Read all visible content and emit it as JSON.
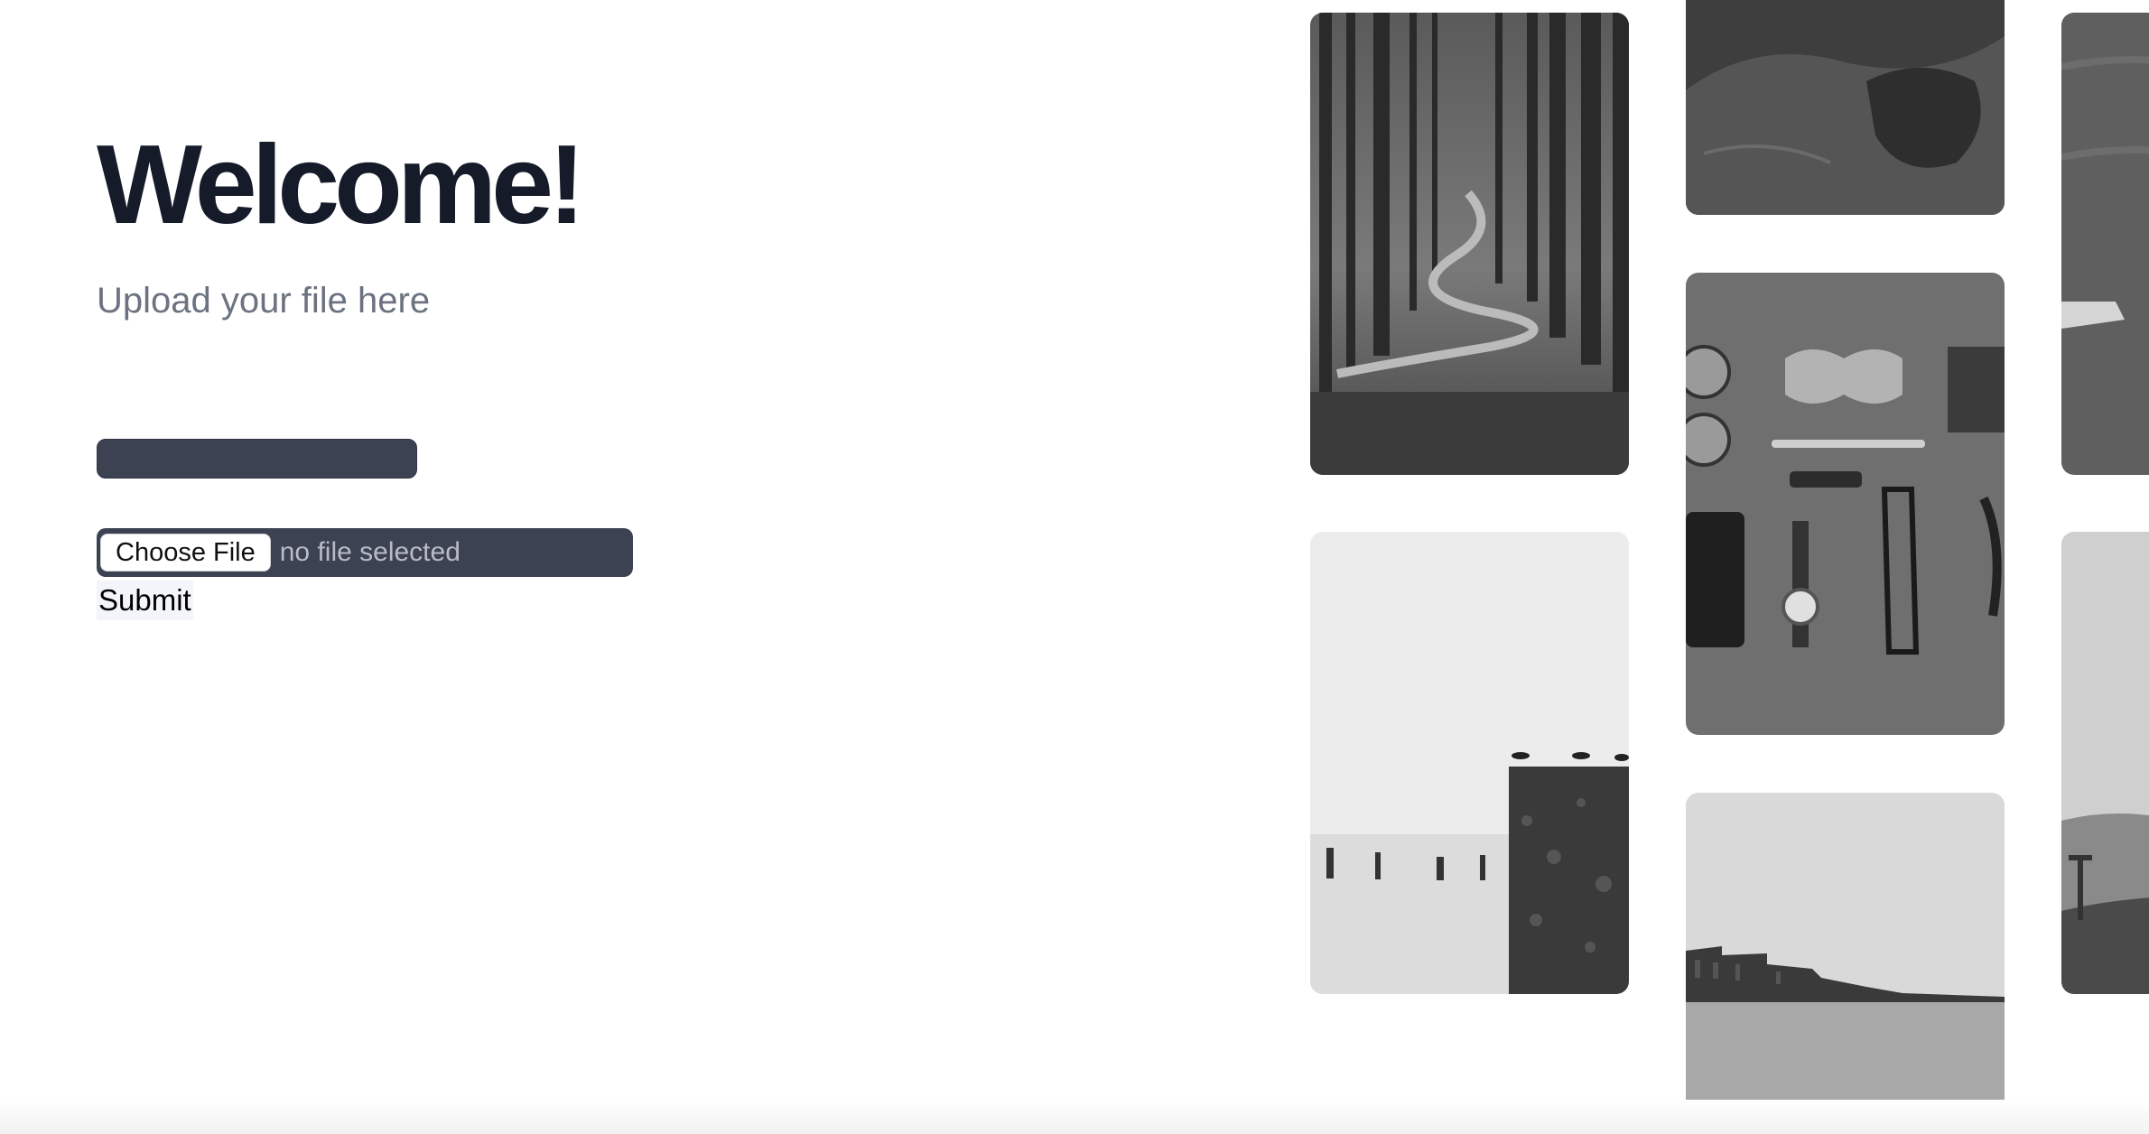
{
  "hero": {
    "title": "Welcome!",
    "subtitle": "Upload your file here"
  },
  "form": {
    "choose_file_label": "Choose File",
    "file_status": "no file selected",
    "submit_label": "Submit"
  },
  "colors": {
    "title": "#161b2a",
    "subtitle": "#6b7280",
    "input_bg": "#3c4252",
    "submit_bg": "#f3f5fa"
  },
  "gallery": {
    "photos": [
      "forest-path-photo",
      "rock-photo",
      "water-photo",
      "flatlay-accessories-photo",
      "birds-on-pillar-photo",
      "waterfront-city-photo",
      "coastal-hills-photo"
    ]
  }
}
